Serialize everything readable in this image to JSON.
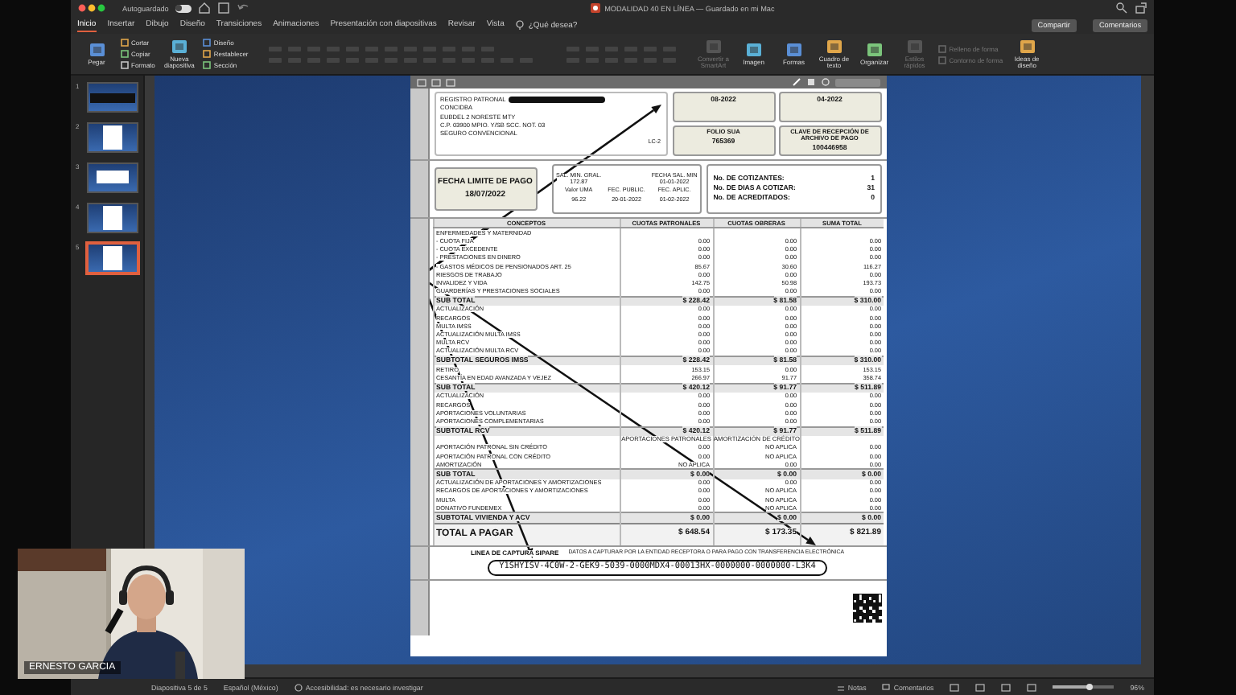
{
  "window": {
    "autosave_label": "Autoguardado",
    "autosave_on": false,
    "title": "MODALIDAD 40 EN LÍNEA — Guardado en mi Mac"
  },
  "tabs": [
    {
      "label": "Inicio",
      "selected": true
    },
    {
      "label": "Insertar",
      "selected": false
    },
    {
      "label": "Dibujo",
      "selected": false
    },
    {
      "label": "Diseño",
      "selected": false
    },
    {
      "label": "Transiciones",
      "selected": false
    },
    {
      "label": "Animaciones",
      "selected": false
    },
    {
      "label": "Presentación con diapositivas",
      "selected": false
    },
    {
      "label": "Revisar",
      "selected": false
    },
    {
      "label": "Vista",
      "selected": false
    }
  ],
  "help_search": "¿Qué desea?",
  "share_buttons": [
    "Compartir",
    "Comentarios"
  ],
  "ribbon": [
    {
      "label": "Pegar",
      "kind": "large",
      "disabled": false
    },
    {
      "label": "Cortar",
      "kind": "small",
      "disabled": false
    },
    {
      "label": "Copiar",
      "kind": "small",
      "disabled": false
    },
    {
      "label": "Formato",
      "kind": "small",
      "disabled": false
    },
    {
      "label": "Nueva diapositiva",
      "kind": "large",
      "disabled": false
    },
    {
      "label": "Diseño",
      "kind": "small",
      "disabled": false
    },
    {
      "label": "Restablecer",
      "kind": "small",
      "disabled": false
    },
    {
      "label": "Sección",
      "kind": "small",
      "disabled": false
    },
    {
      "label": "Convertir a SmartArt",
      "kind": "large",
      "disabled": true
    },
    {
      "label": "Imagen",
      "kind": "large",
      "disabled": false
    },
    {
      "label": "Formas",
      "kind": "large",
      "disabled": false
    },
    {
      "label": "Cuadro de texto",
      "kind": "large",
      "disabled": false
    },
    {
      "label": "Organizar",
      "kind": "large",
      "disabled": false
    },
    {
      "label": "Estilos rápidos",
      "kind": "large",
      "disabled": true
    },
    {
      "label": "Relleno de forma",
      "kind": "small",
      "disabled": true
    },
    {
      "label": "Contorno de forma",
      "kind": "small",
      "disabled": true
    },
    {
      "label": "Ideas de diseño",
      "kind": "large",
      "disabled": false
    }
  ],
  "slides": [
    {
      "number": "1",
      "selected": false
    },
    {
      "number": "2",
      "selected": false
    },
    {
      "number": "3",
      "selected": false
    },
    {
      "number": "4",
      "selected": false
    },
    {
      "number": "5",
      "selected": true
    }
  ],
  "document": {
    "header_lines": [
      "REGISTRO PATRONAL",
      "CONCIDBA",
      "EUBDEL 2 NORESTE MTY",
      "C.P. 03900 MPIO. Y/SB SCC. NOT. 03",
      "SEGURO CONVENCIONAL"
    ],
    "form_code": "LC-2",
    "boxes": [
      {
        "value": "08-2022"
      },
      {
        "value": "04-2022"
      },
      {
        "label": "FOLIO SUA",
        "value": "765369"
      },
      {
        "label": "CLAVE DE RECEPCIÓN DE ARCHIVO DE PAGO",
        "value": "100446958"
      }
    ],
    "due_date": {
      "label": "FECHA LIMITE DE PAGO",
      "value": "18/07/2022"
    },
    "wage_info": [
      {
        "label": "SAL. MIN. GRAL.",
        "value": "172.87"
      },
      {
        "label": "FECHA SAL. MIN",
        "value": "01-01-2022"
      },
      {
        "label": "Valor UMA",
        "value": "96.22"
      },
      {
        "label": "FEC. PUBLIC.",
        "value": "20-01-2022"
      },
      {
        "label": "FEC. APLIC.",
        "value": "01-02-2022"
      }
    ],
    "counts": [
      {
        "label": "No. DE COTIZANTES:",
        "value": "1"
      },
      {
        "label": "No. DE DIAS A COTIZAR:",
        "value": "31"
      },
      {
        "label": "No. DE ACREDITADOS:",
        "value": "0"
      }
    ],
    "table": {
      "columns": [
        "CONCEPTOS",
        "CUOTAS PATRONALES",
        "CUOTAS OBRERAS",
        "SUMA TOTAL"
      ],
      "rows": [
        {
          "kind": "section",
          "cells": [
            "ENFERMEDADES Y MATERNIDAD"
          ]
        },
        {
          "kind": "item",
          "cells": [
            "- CUOTA FIJA",
            "0.00",
            "0.00",
            "0.00"
          ]
        },
        {
          "kind": "item",
          "cells": [
            "- CUOTA EXCEDENTE",
            "0.00",
            "0.00",
            "0.00"
          ]
        },
        {
          "kind": "item",
          "cells": [
            "- PRESTACIONES EN DINERO",
            "0.00",
            "0.00",
            "0.00"
          ]
        },
        {
          "kind": "item",
          "cells": [
            "- GASTOS MÉDICOS DE PENSIONADOS ART. 25",
            "85.67",
            "30.60",
            "116.27"
          ]
        },
        {
          "kind": "item",
          "cells": [
            "RIESGOS DE TRABAJO",
            "0.00",
            "0.00",
            "0.00"
          ]
        },
        {
          "kind": "item",
          "cells": [
            "INVALIDEZ Y VIDA",
            "142.75",
            "50.98",
            "193.73"
          ]
        },
        {
          "kind": "item",
          "cells": [
            "GUARDERÍAS Y PRESTACIONES SOCIALES",
            "0.00",
            "0.00",
            "0.00"
          ]
        },
        {
          "kind": "subtotal",
          "cells": [
            "SUB TOTAL",
            "$ 228.42",
            "$ 81.58",
            "$ 310.00"
          ]
        },
        {
          "kind": "item",
          "cells": [
            "ACTUALIZACIÓN",
            "0.00",
            "0.00",
            "0.00"
          ]
        },
        {
          "kind": "item",
          "cells": [
            "RECARGOS",
            "0.00",
            "0.00",
            "0.00"
          ]
        },
        {
          "kind": "item",
          "cells": [
            "MULTA IMSS",
            "0.00",
            "0.00",
            "0.00"
          ]
        },
        {
          "kind": "item",
          "cells": [
            "ACTUALIZACIÓN MULTA IMSS",
            "0.00",
            "0.00",
            "0.00"
          ]
        },
        {
          "kind": "item",
          "cells": [
            "MULTA RCV",
            "0.00",
            "0.00",
            "0.00"
          ]
        },
        {
          "kind": "item",
          "cells": [
            "ACTUALIZACIÓN MULTA RCV",
            "0.00",
            "0.00",
            "0.00"
          ]
        },
        {
          "kind": "subtotal",
          "cells": [
            "SUBTOTAL SEGUROS IMSS",
            "$ 228.42",
            "$ 81.58",
            "$ 310.00"
          ]
        },
        {
          "kind": "item",
          "cells": [
            "RETIRO",
            "153.15",
            "0.00",
            "153.15"
          ]
        },
        {
          "kind": "item",
          "cells": [
            "CESANTÍA EN EDAD AVANZADA Y VEJEZ",
            "266.97",
            "91.77",
            "358.74"
          ]
        },
        {
          "kind": "subtotal",
          "cells": [
            "SUB TOTAL",
            "$ 420.12",
            "$ 91.77",
            "$ 511.89"
          ]
        },
        {
          "kind": "item",
          "cells": [
            "ACTUALIZACIÓN",
            "0.00",
            "0.00",
            "0.00"
          ]
        },
        {
          "kind": "item",
          "cells": [
            "RECARGOS",
            "0.00",
            "0.00",
            "0.00"
          ]
        },
        {
          "kind": "item",
          "cells": [
            "APORTACIONES VOLUNTARIAS",
            "0.00",
            "0.00",
            "0.00"
          ]
        },
        {
          "kind": "item",
          "cells": [
            "APORTACIONES COMPLEMENTARIAS",
            "0.00",
            "0.00",
            "0.00"
          ]
        },
        {
          "kind": "subtotal",
          "cells": [
            "SUBTOTAL RCV",
            "$ 420.12",
            "$ 91.77",
            "$ 511.89"
          ]
        },
        {
          "kind": "subheader",
          "cells": [
            "",
            "APORTACIONES PATRONALES",
            "AMORTIZACIÓN DE CRÉDITO",
            ""
          ]
        },
        {
          "kind": "item",
          "cells": [
            "APORTACIÓN PATRONAL SIN CRÉDITO",
            "0.00",
            "NO APLICA",
            "0.00"
          ]
        },
        {
          "kind": "item",
          "cells": [
            "APORTACIÓN PATRONAL CON CRÉDITO",
            "0.00",
            "NO APLICA",
            "0.00"
          ]
        },
        {
          "kind": "item",
          "cells": [
            "AMORTIZACIÓN",
            "NO APLICA",
            "0.00",
            "0.00"
          ]
        },
        {
          "kind": "subtotal",
          "cells": [
            "SUB TOTAL",
            "$ 0.00",
            "$ 0.00",
            "$ 0.00"
          ]
        },
        {
          "kind": "item",
          "cells": [
            "ACTUALIZACIÓN DE APORTACIONES Y AMORTIZACIONES",
            "0.00",
            "0.00",
            "0.00"
          ]
        },
        {
          "kind": "item",
          "cells": [
            "RECARGOS DE APORTACIONES Y AMORTIZACIONES",
            "0.00",
            "NO APLICA",
            "0.00"
          ]
        },
        {
          "kind": "item",
          "cells": [
            "MULTA",
            "0.00",
            "NO APLICA",
            "0.00"
          ]
        },
        {
          "kind": "item",
          "cells": [
            "DONATIVO FUNDEMEX",
            "0.00",
            "NO APLICA",
            "0.00"
          ]
        },
        {
          "kind": "subtotal",
          "cells": [
            "SUBTOTAL VIVIENDA Y ACV",
            "$ 0.00",
            "$ 0.00",
            "$ 0.00"
          ]
        },
        {
          "kind": "total",
          "cells": [
            "TOTAL A PAGAR",
            "$ 648.54",
            "$ 173.35",
            "$ 821.89"
          ]
        }
      ]
    },
    "capture_line": {
      "title": "LINEA DE CAPTURA SIPARE",
      "note": "DATOS A CAPTURAR POR LA ENTIDAD RECEPTORA O PARA PAGO CON TRANSFERENCIA ELECTRÓNICA",
      "code": "Y1SHYISV-4C0W-2-GEK9-5039-0000MDX4-00013HX-0000000-0000000-L3K4"
    }
  },
  "status_bar": {
    "slide_count": "Diapositiva 5 de 5",
    "language": "Español (México)",
    "accessibility": "Accesibilidad: es necesario investigar",
    "notes": "Notas",
    "comments": "Comentarios",
    "zoom": "96%",
    "zoom_slider": {
      "level": 0.6
    }
  },
  "webcam": {
    "name": "ERNESTO GARCIA"
  }
}
